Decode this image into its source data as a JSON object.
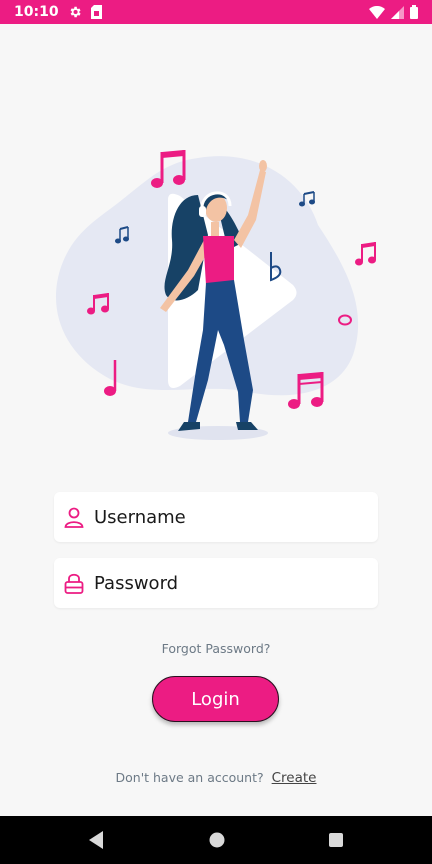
{
  "status_bar": {
    "time": "10:10",
    "icons": [
      "gear-icon",
      "sim-card-icon",
      "wifi-icon",
      "signal-icon",
      "battery-icon"
    ],
    "color": "#ec1c83"
  },
  "illustration": {
    "icon": "music-dance-illustration",
    "accent": "#ec1c83",
    "figure": "#1d4a86",
    "blob": "#e5e8f3"
  },
  "form": {
    "username": {
      "placeholder": "Username",
      "value": "",
      "icon": "user-icon"
    },
    "password": {
      "placeholder": "Password",
      "value": "",
      "icon": "lock-icon"
    }
  },
  "forgot_password": "Forgot Password?",
  "login_button": {
    "label": "Login",
    "color": "#ec1c83"
  },
  "signup": {
    "prompt": "Don't have an account?",
    "link": "Create"
  },
  "nav_bar": {
    "buttons": [
      "back-icon",
      "home-icon",
      "recents-icon"
    ]
  }
}
